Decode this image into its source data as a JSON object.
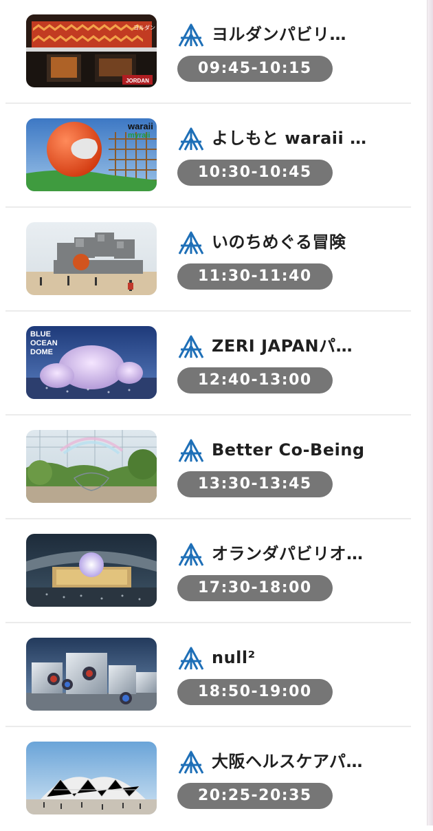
{
  "colors": {
    "logo": "#1e6fb7",
    "time_pill": "#767676",
    "title_text": "#1f1f1f"
  },
  "items": [
    {
      "title": "ヨルダンパビリ…",
      "time": "09:45-10:15",
      "thumb_sign": "JORDAN",
      "thumb_sign2": "ヨルダン"
    },
    {
      "title": "よしもと waraii …",
      "time": "10:30-10:45",
      "thumb_sign": "waraii",
      "thumb_sign2": "myraii"
    },
    {
      "title": "いのちめぐる冒険",
      "time": "11:30-11:40"
    },
    {
      "title": "ZERI JAPANパ…",
      "time": "12:40-13:00",
      "thumb_sign": "BLUE",
      "thumb_sign2": "OCEAN",
      "thumb_sign3": "DOME"
    },
    {
      "title": "Better Co-Being",
      "time": "13:30-13:45"
    },
    {
      "title": "オランダパビリオ…",
      "time": "17:30-18:00"
    },
    {
      "title": "null²",
      "time": "18:50-19:00"
    },
    {
      "title": "大阪ヘルスケアパ…",
      "time": "20:25-20:35"
    }
  ]
}
